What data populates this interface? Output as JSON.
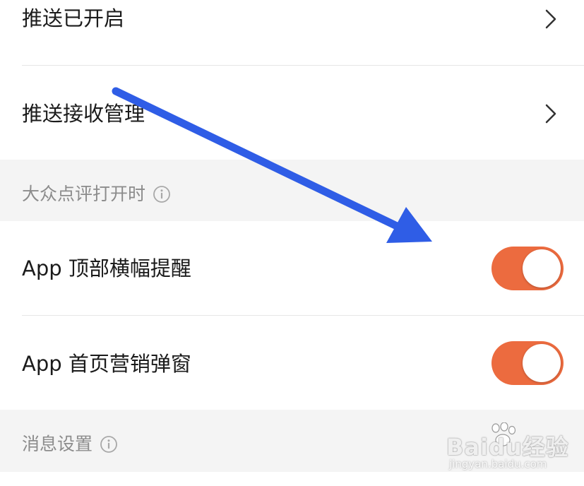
{
  "rows": {
    "push_enabled": {
      "label": "推送已开启"
    },
    "push_receive": {
      "label": "推送接收管理"
    },
    "top_banner": {
      "label": "App 顶部横幅提醒",
      "enabled": true
    },
    "home_popup": {
      "label": "App 首页营销弹窗",
      "enabled": true
    }
  },
  "sections": {
    "when_open": {
      "label": "大众点评打开时"
    },
    "message_settings": {
      "label": "消息设置"
    }
  },
  "icons": {
    "chevron": "chevron-right-icon",
    "info": "info-icon",
    "arrow": "annotation-arrow"
  },
  "colors": {
    "toggle_on": "#ec6b3f",
    "arrow": "#2f5de6",
    "section_bg": "#f4f4f4"
  },
  "watermark": {
    "main": "Baidu经验",
    "sub": "jingyan.baidu.com"
  }
}
